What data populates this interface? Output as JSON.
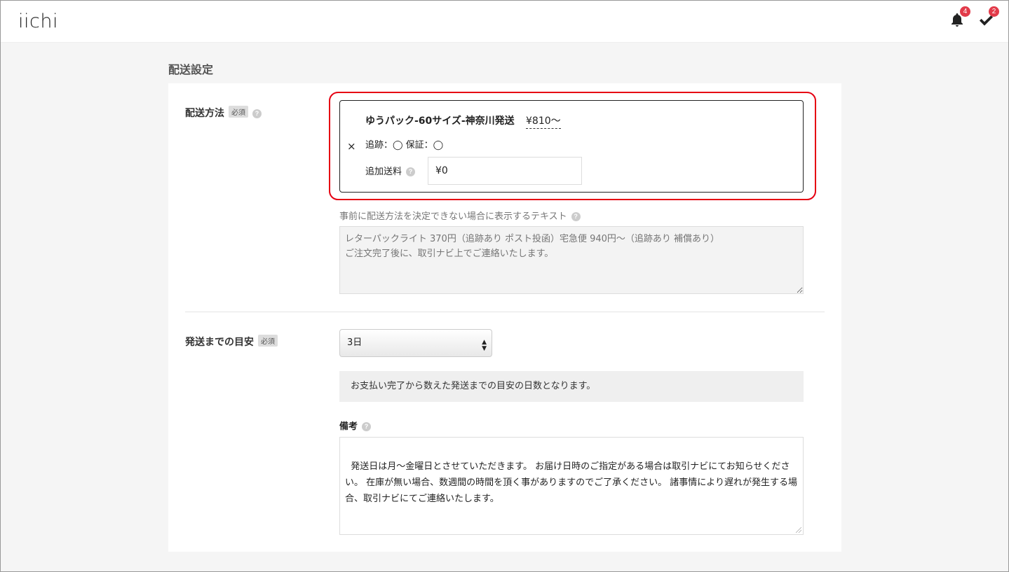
{
  "header": {
    "logo": "iichi",
    "notifications_count": "4",
    "tasks_count": "2"
  },
  "page_title": "配送設定",
  "shipping_method": {
    "label": "配送方法",
    "required": "必須",
    "item": {
      "remove": "×",
      "name": "ゆうパック-60サイズ-神奈川発送",
      "price": "¥810〜",
      "tracking_text": "追跡：◯ 保証：◯",
      "additional_fee_label": "追加送料",
      "additional_fee_value": "¥0"
    },
    "undecided_label": "事前に配送方法を決定できない場合に表示するテキスト",
    "undecided_placeholder": "レターパックライト 370円（追跡あり ポスト投函）宅急便 940円〜（追跡あり 補償あり）\nご注文完了後に、取引ナビ上でご連絡いたします。"
  },
  "shipping_days": {
    "label": "発送までの目安",
    "required": "必須",
    "selected": "3日",
    "info": "お支払い完了から数えた発送までの目安の日数となります。",
    "note_label": "備考",
    "note_value": "発送日は月〜金曜日とさせていただきます。 お届け日時のご指定がある場合は取引ナビにてお知らせください。 在庫が無い場合、数週間の時間を頂く事がありますのでご了承ください。 諸事情により遅れが発生する場合、取引ナビにてご連絡いたします。"
  },
  "colors": {
    "highlight": "#e60012",
    "badge": "#e23b4a"
  }
}
